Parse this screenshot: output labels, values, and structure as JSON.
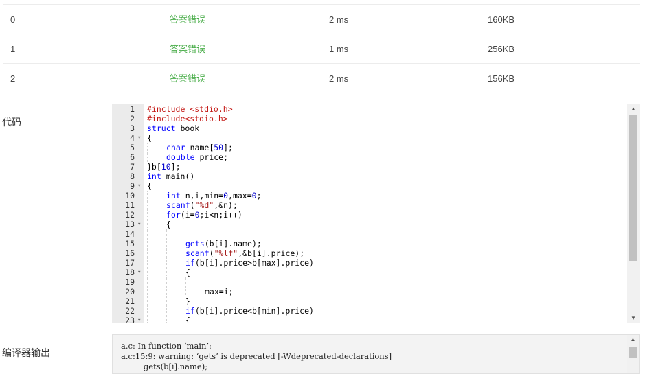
{
  "results": [
    {
      "case": "0",
      "status": "答案错误",
      "time": "2 ms",
      "memory": "160KB"
    },
    {
      "case": "1",
      "status": "答案错误",
      "time": "1 ms",
      "memory": "256KB"
    },
    {
      "case": "2",
      "status": "答案错误",
      "time": "2 ms",
      "memory": "156KB"
    }
  ],
  "code_label": "代码",
  "compiler_label": "编译器输出",
  "code_lines": [
    {
      "n": "1",
      "fold": false,
      "indent": 0,
      "html": "<span class=\"inc\">#include &lt;stdio.h&gt;</span>"
    },
    {
      "n": "2",
      "fold": false,
      "indent": 0,
      "html": "<span class=\"inc\">#include&lt;stdio.h&gt;</span>"
    },
    {
      "n": "3",
      "fold": false,
      "indent": 0,
      "html": "<span class=\"k\">struct</span> book"
    },
    {
      "n": "4",
      "fold": true,
      "indent": 0,
      "html": "{"
    },
    {
      "n": "5",
      "fold": false,
      "indent": 1,
      "html": "<span class=\"k\">char</span> name[<span class=\"n\">50</span>];"
    },
    {
      "n": "6",
      "fold": false,
      "indent": 1,
      "html": "<span class=\"k\">double</span> price;"
    },
    {
      "n": "7",
      "fold": false,
      "indent": 0,
      "html": "}b[<span class=\"n\">10</span>];"
    },
    {
      "n": "8",
      "fold": false,
      "indent": 0,
      "html": "<span class=\"k\">int</span> main()"
    },
    {
      "n": "9",
      "fold": true,
      "indent": 0,
      "html": "{"
    },
    {
      "n": "10",
      "fold": false,
      "indent": 1,
      "html": "<span class=\"k\">int</span> n,i,min=<span class=\"n\">0</span>,max=<span class=\"n\">0</span>;"
    },
    {
      "n": "11",
      "fold": false,
      "indent": 1,
      "html": "<span class=\"k\">scanf</span>(<span class=\"s\">\"%d\"</span>,&amp;n);"
    },
    {
      "n": "12",
      "fold": false,
      "indent": 1,
      "html": "<span class=\"k\">for</span>(i=<span class=\"n\">0</span>;i&lt;n;i++)"
    },
    {
      "n": "13",
      "fold": true,
      "indent": 1,
      "html": "{"
    },
    {
      "n": "14",
      "fold": false,
      "indent": 2,
      "html": ""
    },
    {
      "n": "15",
      "fold": false,
      "indent": 2,
      "html": "<span class=\"k\">gets</span>(b[i].name);"
    },
    {
      "n": "16",
      "fold": false,
      "indent": 2,
      "html": "<span class=\"k\">scanf</span>(<span class=\"s\">\"%lf\"</span>,&amp;b[i].price);"
    },
    {
      "n": "17",
      "fold": false,
      "indent": 2,
      "html": "<span class=\"k\">if</span>(b[i].price&gt;b[max].price)"
    },
    {
      "n": "18",
      "fold": true,
      "indent": 2,
      "html": "{"
    },
    {
      "n": "19",
      "fold": false,
      "indent": 3,
      "html": ""
    },
    {
      "n": "20",
      "fold": false,
      "indent": 3,
      "html": "max=i;"
    },
    {
      "n": "21",
      "fold": false,
      "indent": 2,
      "html": "}"
    },
    {
      "n": "22",
      "fold": false,
      "indent": 2,
      "html": "<span class=\"k\">if</span>(b[i].price&lt;b[min].price)"
    },
    {
      "n": "23",
      "fold": true,
      "indent": 2,
      "html": "{"
    }
  ],
  "compiler_output": "a.c: In function ‘main’:\na.c:15:9: warning: ‘gets’ is deprecated [-Wdeprecated-declarations]\n         gets(b[i].name);\n         ^~~~",
  "icons": {
    "fold": "caret-down",
    "scroll_up": "triangle-up",
    "scroll_down": "triangle-down"
  },
  "colors": {
    "status_error": "#4cae4c",
    "gutter": "#ebebeb",
    "keyword": "#0000ff"
  }
}
